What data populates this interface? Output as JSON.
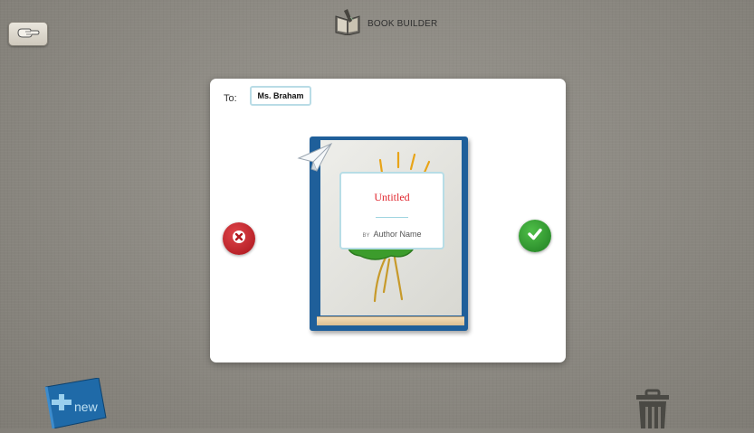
{
  "header": {
    "title": "BOOK BUILDER",
    "icon": "book-builder-icon"
  },
  "toolbar": {
    "back_icon": "hand-pointer-icon"
  },
  "dialog": {
    "to_label": "To:",
    "recipient": "Ms. Braham",
    "cancel_icon": "close-icon",
    "confirm_icon": "checkmark-icon",
    "book": {
      "title": "Untitled",
      "by_label": "BY",
      "author": "Author Name",
      "send_icon": "paper-plane-icon"
    }
  },
  "bottom_bar": {
    "new_label": "new",
    "trash_icon": "trash-icon"
  },
  "colors": {
    "cancel": "#c1212a",
    "confirm": "#2f9a2f",
    "title_red": "#e0262e",
    "book_blue": "#1f5f9a"
  }
}
